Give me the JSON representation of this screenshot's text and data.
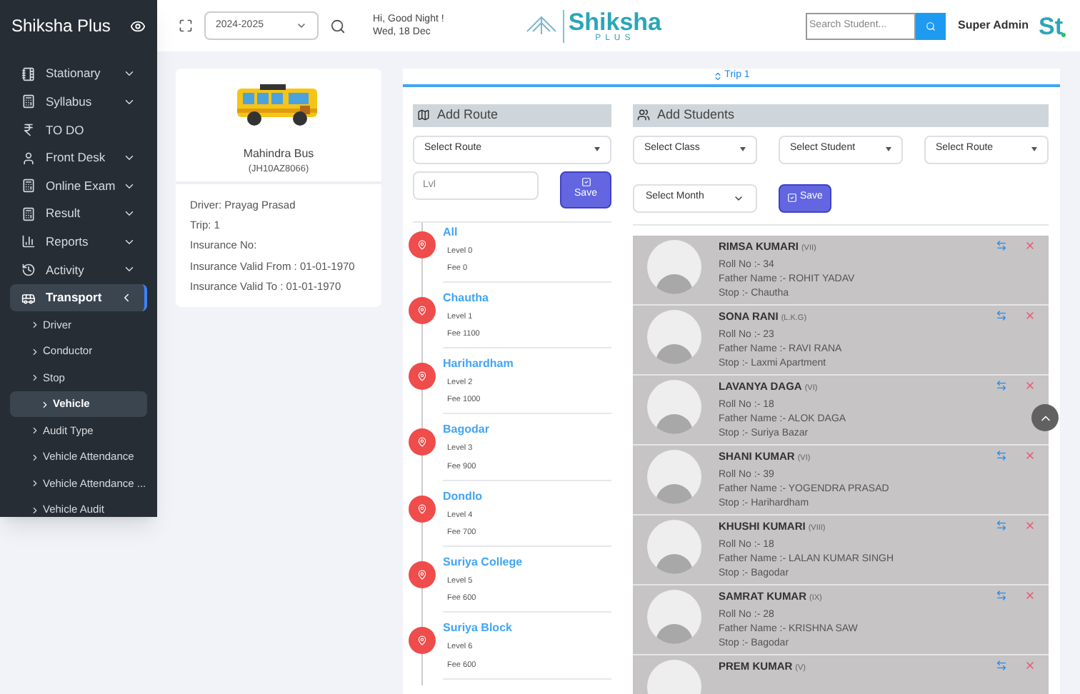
{
  "sidebar": {
    "brand": "Shiksha Plus",
    "items": [
      {
        "label": "Stationary",
        "expandable": true,
        "expanded": false,
        "selected": false
      },
      {
        "label": "Syllabus",
        "expandable": true,
        "expanded": false,
        "selected": false
      },
      {
        "label": "TO DO",
        "expandable": false,
        "expanded": false,
        "selected": false
      },
      {
        "label": "Front Desk",
        "expandable": true,
        "expanded": false,
        "selected": false
      },
      {
        "label": "Online Exam",
        "expandable": true,
        "expanded": false,
        "selected": false
      },
      {
        "label": "Result",
        "expandable": true,
        "expanded": false,
        "selected": false
      },
      {
        "label": "Reports",
        "expandable": true,
        "expanded": false,
        "selected": false
      },
      {
        "label": "Activity",
        "expandable": true,
        "expanded": false,
        "selected": false
      },
      {
        "label": "Transport",
        "expandable": true,
        "expanded": true,
        "selected": true,
        "children": [
          {
            "label": "Driver",
            "selected": false
          },
          {
            "label": "Conductor",
            "selected": false
          },
          {
            "label": "Stop",
            "selected": false
          },
          {
            "label": "Vehicle",
            "selected": true
          },
          {
            "label": "Audit Type",
            "selected": false
          },
          {
            "label": "Vehicle Attendance",
            "selected": false
          },
          {
            "label": "Vehicle Attendance ...",
            "selected": false
          },
          {
            "label": "Vehicle Audit",
            "selected": false
          }
        ]
      }
    ]
  },
  "header": {
    "session": "2024-2025",
    "greeting": "Hi, Good Night !",
    "date": "Wed, 18 Dec",
    "logo": "Shiksha",
    "logo_sub": "PLUS",
    "search": {
      "placeholder": "Search Student..."
    },
    "user": "Super Admin",
    "avatar": "St"
  },
  "vehicle": {
    "name": "Mahindra Bus",
    "registration": "(JH10AZ8066)",
    "details": [
      "Driver: Prayag Prasad",
      "Trip: 1",
      "Insurance No:",
      "Insurance Valid From : 01-01-1970",
      "Insurance Valid To : 01-01-1970"
    ]
  },
  "tabs": [
    {
      "label": "Trip 1",
      "selected": true
    }
  ],
  "add_route": {
    "title": "Add Route",
    "route_select": "Select Route",
    "level": {
      "placeholder": "Lvl"
    },
    "save": "Save",
    "stops": [
      {
        "name": "All",
        "level": "Level 0",
        "fee": "Fee 0"
      },
      {
        "name": "Chautha",
        "level": "Level 1",
        "fee": "Fee 1100"
      },
      {
        "name": "Harihardham",
        "level": "Level 2",
        "fee": "Fee 1000"
      },
      {
        "name": "Bagodar",
        "level": "Level 3",
        "fee": "Fee 900"
      },
      {
        "name": "Dondlo",
        "level": "Level 4",
        "fee": "Fee 700"
      },
      {
        "name": "Suriya College",
        "level": "Level 5",
        "fee": "Fee 600"
      },
      {
        "name": "Suriya Block",
        "level": "Level 6",
        "fee": "Fee 600"
      }
    ]
  },
  "add_students": {
    "title": "Add Students",
    "selects": [
      "Select Class",
      "Select Student",
      "Select Route"
    ],
    "month_select": "Select Month",
    "save": "Save",
    "students": [
      {
        "name": "RIMSA KUMARI",
        "class": "(VII)",
        "roll": "Roll No :- 34",
        "father": "Father Name :- ROHIT YADAV",
        "stop": "Stop :- Chautha"
      },
      {
        "name": "SONA RANI",
        "class": "(L.K.G)",
        "roll": "Roll No :- 23",
        "father": "Father Name :- RAVI RANA",
        "stop": "Stop :- Laxmi Apartment"
      },
      {
        "name": "LAVANYA DAGA",
        "class": "(VI)",
        "roll": "Roll No :- 18",
        "father": "Father Name :- ALOK DAGA",
        "stop": "Stop :- Suriya Bazar"
      },
      {
        "name": "SHANI KUMAR",
        "class": "(VI)",
        "roll": "Roll No :- 39",
        "father": "Father Name :- YOGENDRA PRASAD",
        "stop": "Stop :- Harihardham"
      },
      {
        "name": "KHUSHI KUMARI",
        "class": "(VIII)",
        "roll": "Roll No :- 18",
        "father": "Father Name :- LALAN KUMAR SINGH",
        "stop": "Stop :- Bagodar"
      },
      {
        "name": "SAMRAT KUMAR",
        "class": "(IX)",
        "roll": "Roll No :- 28",
        "father": "Father Name :- KRISHNA SAW",
        "stop": "Stop :- Bagodar"
      },
      {
        "name": "PREM KUMAR",
        "class": "(V)"
      }
    ]
  }
}
